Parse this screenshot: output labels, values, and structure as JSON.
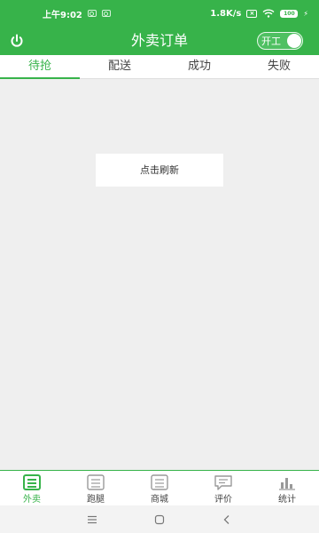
{
  "status_bar": {
    "time": "上午9:02",
    "speed": "1.8K/s",
    "battery": "100"
  },
  "header": {
    "title": "外卖订单",
    "toggle_label": "开工"
  },
  "tabs": [
    {
      "label": "待抢"
    },
    {
      "label": "配送"
    },
    {
      "label": "成功"
    },
    {
      "label": "失败"
    }
  ],
  "main": {
    "refresh_label": "点击刷新"
  },
  "bottom_nav": [
    {
      "label": "外卖",
      "icon": "takeout-icon",
      "active": true
    },
    {
      "label": "跑腿",
      "icon": "errand-icon",
      "active": false
    },
    {
      "label": "商城",
      "icon": "mall-icon",
      "active": false
    },
    {
      "label": "评价",
      "icon": "review-icon",
      "active": false
    },
    {
      "label": "统计",
      "icon": "stats-icon",
      "active": false
    }
  ],
  "colors": {
    "brand": "#37b34a",
    "background": "#efefef"
  }
}
